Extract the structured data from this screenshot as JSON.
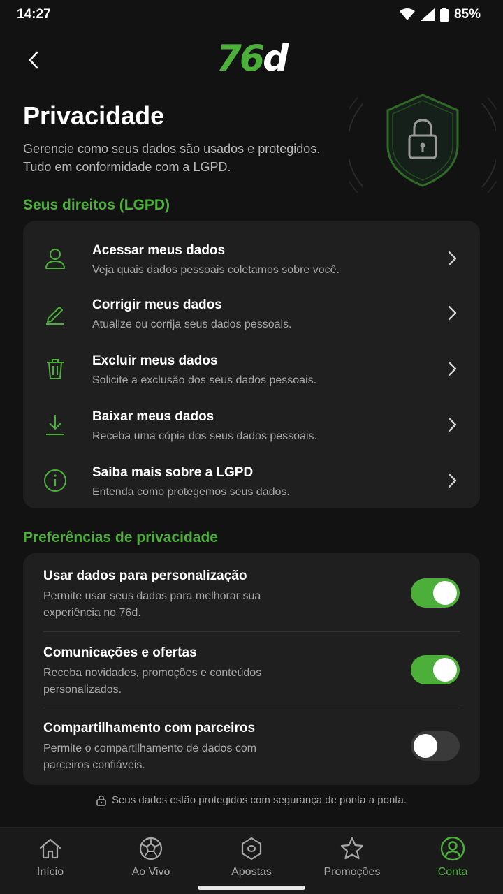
{
  "status_bar": {
    "time": "14:27",
    "battery": "85%"
  },
  "header": {
    "logo_number": "76",
    "logo_letter": "d"
  },
  "hero": {
    "title": "Privacidade",
    "subtitle_line1": "Gerencie como seus dados são usados e protegidos.",
    "subtitle_line2": "Tudo em conformidade com a LGPD."
  },
  "rights": {
    "section_title": "Seus direitos (LGPD)",
    "items": [
      {
        "icon": "user-icon",
        "title": "Acessar meus dados",
        "description": "Veja quais dados pessoais coletamos sobre você."
      },
      {
        "icon": "pencil-icon",
        "title": "Corrigir meus dados",
        "description": "Atualize ou corrija seus dados pessoais."
      },
      {
        "icon": "trash-icon",
        "title": "Excluir meus dados",
        "description": "Solicite a exclusão dos seus dados pessoais."
      },
      {
        "icon": "download-icon",
        "title": "Baixar meus dados",
        "description": "Receba uma cópia dos seus dados pessoais."
      },
      {
        "icon": "info-icon",
        "title": "Saiba mais sobre a LGPD",
        "description": "Entenda como protegemos seus dados."
      }
    ]
  },
  "preferences": {
    "section_title": "Preferências de privacidade",
    "items": [
      {
        "title": "Usar dados para personalização",
        "description_line1": "Permite usar seus dados para melhorar sua",
        "description_line2": "experiência no 76d.",
        "enabled": true
      },
      {
        "title": "Comunicações e ofertas",
        "description_line1": "Receba novidades, promoções e conteúdos",
        "description_line2": "personalizados.",
        "enabled": true
      },
      {
        "title": "Compartilhamento com parceiros",
        "description_line1": "Permite o compartilhamento de dados com",
        "description_line2": "parceiros confiáveis.",
        "enabled": false
      }
    ]
  },
  "footnote": "Seus dados estão protegidos com segurança de ponta a ponta.",
  "bottom_nav": {
    "items": [
      {
        "icon": "home-icon",
        "label": "Início",
        "active": false
      },
      {
        "icon": "soccer-ball-icon",
        "label": "Ao Vivo",
        "active": false
      },
      {
        "icon": "ticket-icon",
        "label": "Apostas",
        "active": false
      },
      {
        "icon": "star-icon",
        "label": "Promoções",
        "active": false
      },
      {
        "icon": "account-icon",
        "label": "Conta",
        "active": true
      }
    ]
  },
  "colors": {
    "accent": "#4caf3a",
    "background": "#121212",
    "card": "#1f1f1f",
    "muted_text": "#a8a8a8"
  }
}
